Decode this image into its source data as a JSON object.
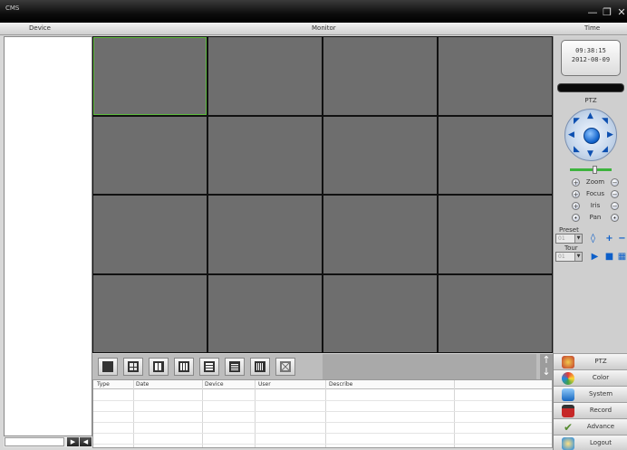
{
  "window": {
    "title": "CMS",
    "controls": {
      "minimize": "—",
      "restore": "❐",
      "close": "✕"
    }
  },
  "header": {
    "device_label": "Device",
    "monitor_label": "Monitor",
    "time_label": "Time"
  },
  "clock": {
    "time": "09:38:15",
    "date": "2012-08-09"
  },
  "ptz": {
    "title": "PTZ",
    "zoom_label": "Zoom",
    "focus_label": "Focus",
    "iris_label": "Iris",
    "pan_label": "Pan",
    "preset_label": "Preset",
    "preset_value": "01",
    "tour_label": "Tour",
    "tour_value": "01",
    "speed_level": 0.62
  },
  "log_table": {
    "columns": [
      "Type",
      "Date",
      "Device",
      "User",
      "Describe"
    ]
  },
  "nav": [
    {
      "label": "PTZ",
      "icon": "ptz-icon",
      "color": "#c0392b"
    },
    {
      "label": "Color",
      "icon": "color-icon",
      "color": "#2e7d32"
    },
    {
      "label": "System",
      "icon": "system-icon",
      "color": "#1565c0"
    },
    {
      "label": "Record",
      "icon": "record-icon",
      "color": "#c62828"
    },
    {
      "label": "Advance",
      "icon": "advance-icon",
      "color": "#558b2f"
    },
    {
      "label": "Logout",
      "icon": "logout-icon",
      "color": "#1e88e5"
    }
  ],
  "colors": {
    "cell": "#6e6e6e",
    "active_cell": "#5dbb3c",
    "ptz_blue": "#0d5fc9"
  }
}
